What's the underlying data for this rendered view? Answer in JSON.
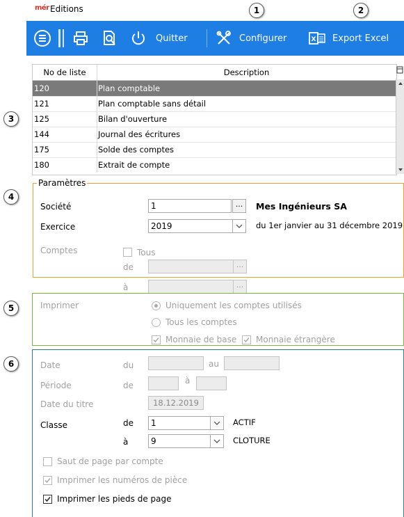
{
  "app": {
    "logo_text": "mér",
    "title": "Editions"
  },
  "toolbar": {
    "quit_label": "Quitter",
    "configure_label": "Configurer",
    "export_label": "Export Excel",
    "icons": [
      "menu-icon",
      "print-icon",
      "preview-icon",
      "power-icon",
      "tools-icon",
      "excel-icon"
    ]
  },
  "markers": [
    "1",
    "2",
    "3",
    "4",
    "5",
    "6"
  ],
  "list": {
    "headers": {
      "no": "No de liste",
      "desc": "Description"
    },
    "rows": [
      {
        "no": "120",
        "desc": "Plan comptable",
        "selected": true
      },
      {
        "no": "121",
        "desc": "Plan comptable sans détail"
      },
      {
        "no": "125",
        "desc": "Bilan d'ouverture"
      },
      {
        "no": "144",
        "desc": "Journal des écritures"
      },
      {
        "no": "175",
        "desc": "Solde des comptes"
      },
      {
        "no": "180",
        "desc": "Extrait de compte"
      }
    ]
  },
  "parametres": {
    "legend": "Paramètres",
    "societe_label": "Société",
    "societe_value": "1",
    "societe_button": "...",
    "societe_name": "Mes Ingénieurs SA",
    "exercice_label": "Exercice",
    "exercice_value": "2019",
    "exercice_range": "du 1er janvier au 31 décembre 2019",
    "comptes_label": "Comptes",
    "tous_label": "Tous",
    "de_label": "de",
    "a_label": "à",
    "dots": "..."
  },
  "imprimer": {
    "label": "Imprimer",
    "opt_used": "Uniquement les comptes utilisés",
    "opt_all": "Tous les comptes",
    "monnaie_base": "Monnaie de base",
    "monnaie_etrangere": "Monnaie étrangère"
  },
  "options": {
    "date_label": "Date",
    "date_du": "du",
    "date_au": "au",
    "periode_label": "Période",
    "periode_de": "de",
    "periode_a": "à",
    "date_titre_label": "Date du titre",
    "date_titre_value": "18.12.2019",
    "classe_label": "Classe",
    "classe_de": "de",
    "classe_de_value": "1",
    "classe_de_name": "ACTIF",
    "classe_a": "à",
    "classe_a_value": "9",
    "classe_a_name": "CLOTURE",
    "saut_page": "Saut de page par compte",
    "num_piece": "Imprimer les numéros de pièce",
    "pieds_page": "Imprimer les pieds de page"
  },
  "colors": {
    "toolbar": "#1e7ee4",
    "selected_row": "#7a7a7a",
    "box4": "#f0a030",
    "box5": "#7cb342",
    "box6": "#2a7f8f"
  }
}
